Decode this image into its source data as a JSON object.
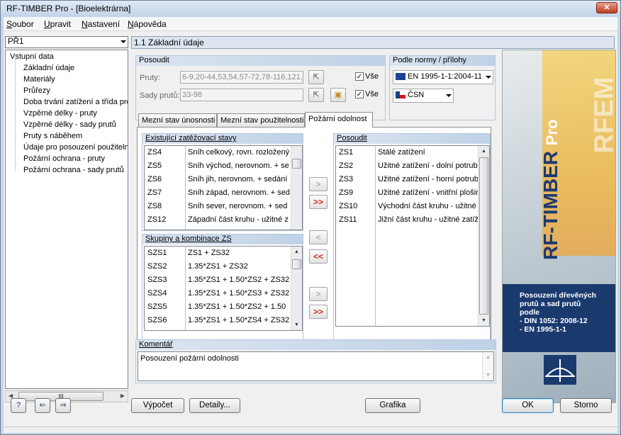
{
  "window": {
    "title": "RF-TIMBER Pro - [Bioelektrárna]",
    "close_glyph": "✕"
  },
  "menu": [
    {
      "u": "S",
      "rest": "oubor"
    },
    {
      "u": "U",
      "rest": "pravit"
    },
    {
      "u": "N",
      "rest": "astavení"
    },
    {
      "u": "N",
      "rest": "ápověda"
    }
  ],
  "nav": {
    "case": "PŘ1",
    "tree_root": "Vstupní data",
    "tree_items": [
      "Základní údaje",
      "Materiály",
      "Průřezy",
      "Doba trvání zatížení a třída pro",
      "Vzpěrné délky - pruty",
      "Vzpěrné délky - sady prutů",
      "Pruty s náběhem",
      "Údaje pro posouzení použitelno",
      "Požární ochrana - pruty",
      "Požární ochrana - sady prutů"
    ],
    "hscroll_grip": "III"
  },
  "section_title": "1.1 Základní údaje",
  "posoudit": {
    "title": "Posoudit",
    "members_label": "Pruty:",
    "members_value": "6-9,20-44,53,54,57-72,78-116,121,1",
    "sets_label": "Sady prutů:",
    "sets_value": "33-98",
    "all1": "Vše",
    "all2": "Vše"
  },
  "norm": {
    "title": "Podle normy / přílohy",
    "standard": "EN 1995-1-1:2004-11",
    "annex": "ČSN"
  },
  "tabs": [
    "Mezní stav únosnosti",
    "Mezní stav použitelnosti",
    "Požární odolnost"
  ],
  "existing": {
    "title": "Existující zatěžovací stavy",
    "rows": [
      [
        "ZS4",
        "Sníh celkový, rovn. rozložený"
      ],
      [
        "ZS5",
        "Sníh východ, nerovnom. + se"
      ],
      [
        "ZS6",
        "Sníh jih, nerovnom. + sedání"
      ],
      [
        "ZS7",
        "Sníh západ, nerovnom. + sed"
      ],
      [
        "ZS8",
        "Sníh sever, nerovnom. + sed"
      ],
      [
        "ZS12",
        "Západní část kruhu - užitné z"
      ]
    ]
  },
  "groups": {
    "title": "Skupiny a kombinace ZS",
    "rows": [
      [
        "SZS1",
        "ZS1 + ZS32"
      ],
      [
        "SZS2",
        "1.35*ZS1 + ZS32"
      ],
      [
        "SZS3",
        "1.35*ZS1 + 1.50*ZS2 + ZS32"
      ],
      [
        "SZS4",
        "1.35*ZS1 + 1.50*ZS3 + ZS32"
      ],
      [
        "SZS5",
        "1.35*ZS1 + 1.50*ZS2 + 1.50"
      ],
      [
        "SZS6",
        "1.35*ZS1 + 1.50*ZS4 + ZS32"
      ]
    ]
  },
  "design": {
    "title": "Posoudit",
    "rows": [
      [
        "ZS1",
        "Stálé zatížení"
      ],
      [
        "ZS2",
        "Užitné zatížení - dolní potrub"
      ],
      [
        "ZS3",
        "Užitné zatížení - horní potrub"
      ],
      [
        "ZS9",
        "Užitné zatížení - vnitřní plošin"
      ],
      [
        "ZS10",
        "Východní část kruhu - užitné"
      ],
      [
        "ZS11",
        "Jižní část kruhu - užitné zatíž"
      ]
    ]
  },
  "arrows": {
    "add": ">",
    "add_all": ">>",
    "remove": "<",
    "remove_all": "<<"
  },
  "comment": {
    "title": "Komentář",
    "text": "Posouzení požární odolnosti"
  },
  "banner": {
    "brand": "RF-TIMBER",
    "brand_suffix": "Pro",
    "watermark": "RFEM",
    "desc": [
      "Posouzení dřevěných",
      "prutů a sad prutů",
      "podle",
      "- DIN 1052: 2008-12",
      "- EN 1995-1-1"
    ]
  },
  "buttons": {
    "calc": "Výpočet",
    "details": "Detaily...",
    "graphics": "Grafika",
    "ok": "OK",
    "cancel": "Storno"
  },
  "icons": {
    "help": "?",
    "import": "⇐",
    "export": "⇒"
  }
}
